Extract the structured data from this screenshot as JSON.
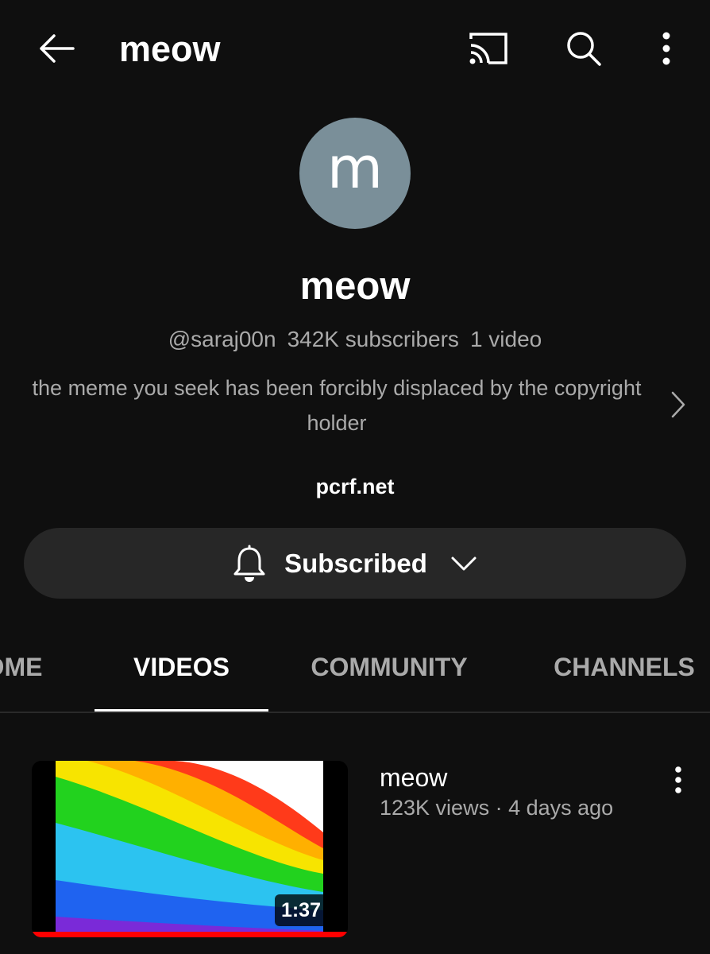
{
  "header": {
    "title": "meow",
    "icons": [
      "back-arrow-icon",
      "cast-icon",
      "search-icon",
      "more-vertical-icon"
    ]
  },
  "channel": {
    "avatar_letter": "m",
    "avatar_color": "#7a8f99",
    "name": "meow",
    "handle": "@saraj00n",
    "subscribers": "342K subscribers",
    "video_count": "1 video",
    "description": "the meme you seek has been forcibly displaced by the copyright holder",
    "link": "pcrf.net"
  },
  "subscribe": {
    "label": "Subscribed",
    "icons": [
      "bell-icon",
      "chevron-down-icon"
    ]
  },
  "tabs": [
    {
      "label": "OME",
      "active": false
    },
    {
      "label": "VIDEOS",
      "active": true
    },
    {
      "label": "COMMUNITY",
      "active": false
    },
    {
      "label": "CHANNELS",
      "active": false
    }
  ],
  "videos": [
    {
      "title": "meow",
      "meta": "123K views · 4 days ago",
      "duration": "1:37",
      "watched_fraction": 1.0
    }
  ],
  "colors": {
    "background": "#0f0f0f",
    "button_bg": "#272727",
    "secondary_text": "#aaaaaa",
    "progress_red": "#ff0000"
  }
}
